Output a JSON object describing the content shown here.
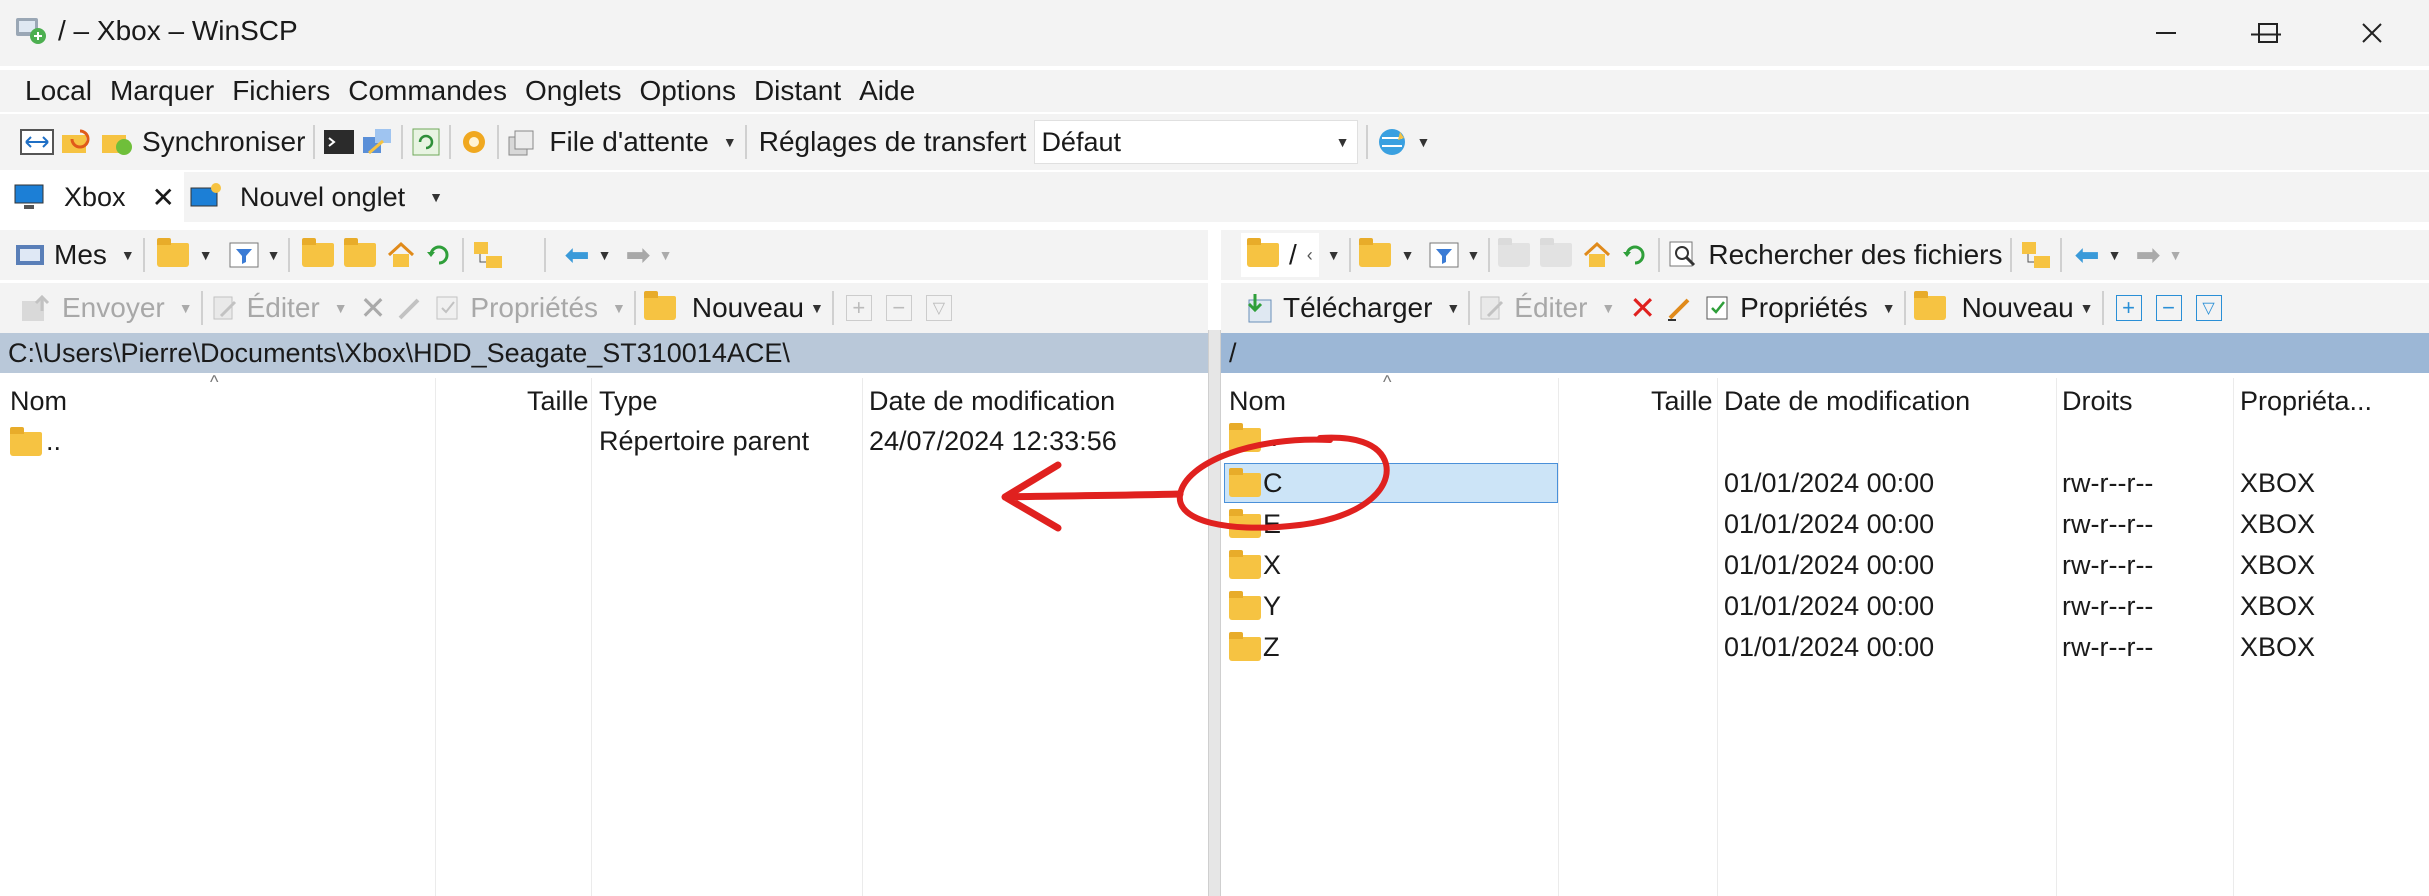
{
  "window": {
    "title": "/ – Xbox – WinSCP",
    "minimize": "—",
    "maximize": "☐",
    "close": "✕"
  },
  "menu": [
    "Local",
    "Marquer",
    "Fichiers",
    "Commandes",
    "Onglets",
    "Options",
    "Distant",
    "Aide"
  ],
  "toolbar": {
    "synchronize": "Synchroniser",
    "queue": "File d'attente",
    "transfer_settings_label": "Réglages de transfert",
    "transfer_settings_value": "Défaut"
  },
  "tabs": {
    "session": "Xbox",
    "new_tab": "Nouvel onglet"
  },
  "left": {
    "location": "Mes",
    "send": "Envoyer",
    "edit": "Éditer",
    "properties": "Propriétés",
    "new": "Nouveau",
    "path": "C:\\Users\\Pierre\\Documents\\Xbox\\HDD_Seagate_ST310014ACE\\",
    "columns": [
      "Nom",
      "Taille",
      "Type",
      "Date de modification"
    ],
    "rows": [
      {
        "name": "..",
        "type": "Répertoire parent",
        "date": "24/07/2024 12:33:56"
      }
    ]
  },
  "right": {
    "location": "/",
    "find": "Rechercher des fichiers",
    "download": "Télécharger",
    "edit": "Éditer",
    "properties": "Propriétés",
    "new": "Nouveau",
    "path": "/",
    "columns": [
      "Nom",
      "Taille",
      "Date de modification",
      "Droits",
      "Propriéta..."
    ],
    "parent": "..",
    "rows": [
      {
        "name": "C",
        "date": "01/01/2024 00:00",
        "rights": "rw-r--r--",
        "owner": "XBOX"
      },
      {
        "name": "E",
        "date": "01/01/2024 00:00",
        "rights": "rw-r--r--",
        "owner": "XBOX"
      },
      {
        "name": "X",
        "date": "01/01/2024 00:00",
        "rights": "rw-r--r--",
        "owner": "XBOX"
      },
      {
        "name": "Y",
        "date": "01/01/2024 00:00",
        "rights": "rw-r--r--",
        "owner": "XBOX"
      },
      {
        "name": "Z",
        "date": "01/01/2024 00:00",
        "rights": "rw-r--r--",
        "owner": "XBOX"
      }
    ]
  },
  "colors": {
    "annotation": "#e0211f",
    "selection": "#cce4f7",
    "path_left": "#b9c8d9",
    "path_right": "#9cb7d6"
  }
}
